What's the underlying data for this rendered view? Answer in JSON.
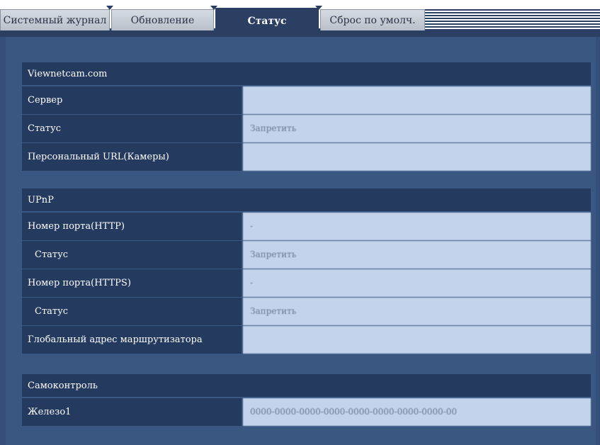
{
  "tabs": [
    {
      "label": "Системный журнал"
    },
    {
      "label": "Обновление"
    },
    {
      "label": "Статус"
    },
    {
      "label": "Сброс по умолч."
    }
  ],
  "sections": {
    "viewnetcam": {
      "header": "Viewnetcam.com",
      "rows": [
        {
          "label": "Сервер",
          "value": ""
        },
        {
          "label": "Статус",
          "value": "Запретить"
        },
        {
          "label": "Персональный URL(Камеры)",
          "value": ""
        }
      ]
    },
    "upnp": {
      "header": "UPnP",
      "rows": [
        {
          "label": "Номер порта(HTTP)",
          "value": "-"
        },
        {
          "label": "Статус",
          "value": "Запретить"
        },
        {
          "label": "Номер порта(HTTPS)",
          "value": "-"
        },
        {
          "label": "Статус",
          "value": "Запретить"
        },
        {
          "label": "Глобальный адрес маршрутизатора",
          "value": ""
        }
      ]
    },
    "selfcheck": {
      "header": "Самоконтроль",
      "rows": [
        {
          "label": "Железо1",
          "value": "0000-0000-0000-0000-0000-0000-0000-0000-00"
        }
      ]
    }
  },
  "colors": {
    "panel": "#3a5782",
    "label_bg": "#243a5e",
    "value_bg": "#c3d3eb",
    "active_tab": "#2b3f63"
  }
}
